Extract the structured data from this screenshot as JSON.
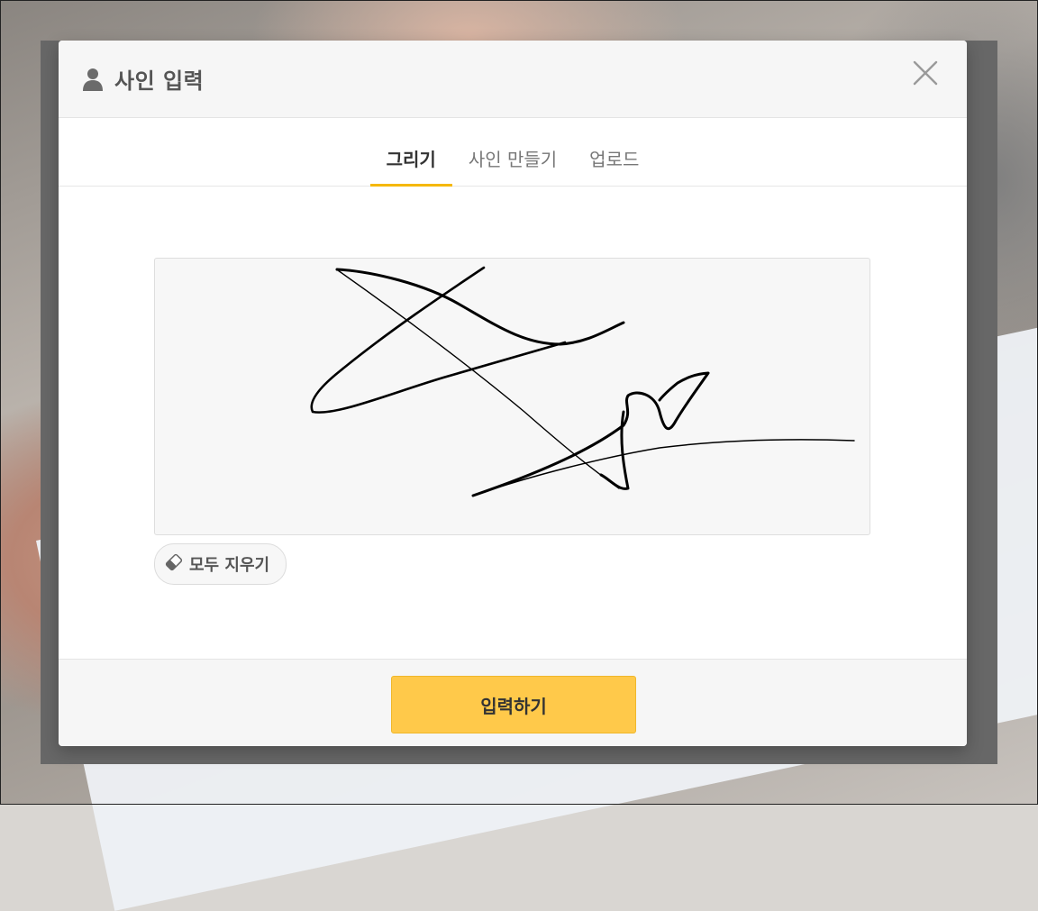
{
  "modal": {
    "title": "사인 입력",
    "user_icon": "user-icon",
    "close_icon": "close-icon"
  },
  "tabs": [
    {
      "label": "그리기",
      "active": true
    },
    {
      "label": "사인 만들기",
      "active": false
    },
    {
      "label": "업로드",
      "active": false
    }
  ],
  "canvas": {
    "stroke_color": "#000000",
    "background_color": "#f7f7f7"
  },
  "clear_button": {
    "label": "모두 지우기",
    "icon": "eraser-icon"
  },
  "footer": {
    "submit_label": "입력하기"
  },
  "colors": {
    "accent": "#f5b800",
    "submit_bg": "#ffc94a"
  }
}
